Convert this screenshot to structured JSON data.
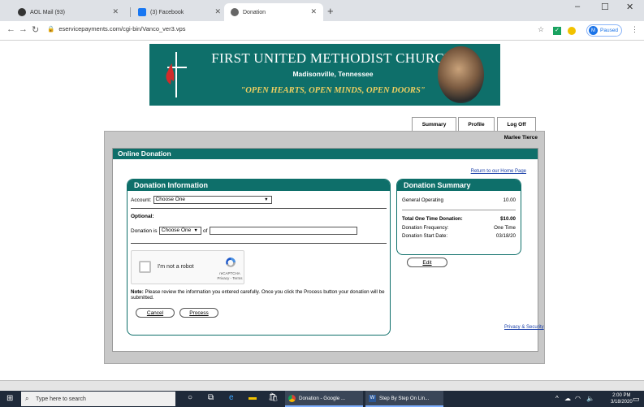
{
  "browser": {
    "tabs": [
      {
        "label": "AOL Mail (93)",
        "active": false
      },
      {
        "label": "(3) Facebook",
        "active": false
      },
      {
        "label": "Donation",
        "active": true
      }
    ],
    "url": "eservicepayments.com/cgi-bin/Vanco_ver3.vps",
    "profile_initial": "M",
    "profile_status": "Paused"
  },
  "banner": {
    "title": "FIRST UNITED METHODIST CHURCH",
    "subtitle": "Madisonville, Tennessee",
    "motto": "\"OPEN HEARTS, OPEN MINDS, OPEN DOORS\""
  },
  "nav": {
    "summary": "Summary",
    "profile": "Profile",
    "logoff": "Log Off"
  },
  "user_name": "Marlee Tierce",
  "section_title": "Online Donation",
  "home_link": "Return to our Home Page",
  "donation_info": {
    "title": "Donation Information",
    "account_label": "Account:",
    "account_value": "Choose One",
    "optional_label": "Optional:",
    "donation_is_label": "Donation is",
    "donation_is_value": "Choose One",
    "of_label": "of",
    "of_value": "",
    "captcha_text": "I'm not a robot",
    "captcha_brand": "reCAPTCHA",
    "captcha_links": "Privacy - Terms",
    "note_bold": "Note:",
    "note_text": "Please review the information you entered carefully. Once you click the Process button your donation will be submitted.",
    "cancel": "Cancel",
    "process": "Process"
  },
  "summary": {
    "title": "Donation Summary",
    "fund_label": "General Operating",
    "fund_amount": "10.00",
    "total_label": "Total One Time Donation:",
    "total_amount": "$10.00",
    "freq_label": "Donation Frequency:",
    "freq_value": "One Time",
    "start_label": "Donation Start Date:",
    "start_value": "03/18/20",
    "edit": "Edit"
  },
  "privacy_link": "Privacy & Security",
  "taskbar": {
    "search_placeholder": "Type here to search",
    "app1": "Donation - Google ...",
    "app2": "Step By Step On Lin...",
    "time": "2:00 PM",
    "date": "3/18/2020"
  },
  "colors": {
    "brand": "#0e6f6a",
    "link": "#1a3fa8",
    "motto": "#f0d060"
  }
}
